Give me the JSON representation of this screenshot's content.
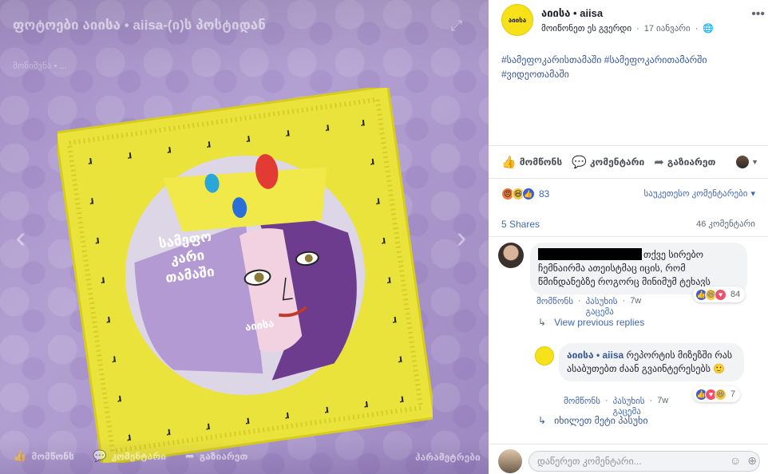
{
  "photo": {
    "title": "ფოტოები აიისა • aiisa-(ი)ს პოსტიდან",
    "subtitle": "მონიშვნა • ...",
    "expand_icon": "expand-icon",
    "package_label_lines": [
      "სამეფო",
      "კარი",
      "თამაში"
    ],
    "brand_mark": "აიისა",
    "bar": {
      "like": "მომწონს",
      "comment": "კომენტარი",
      "share": "გაზიარეთ",
      "options": "პარამეტრები"
    },
    "colors": {
      "background": "#a58fc6",
      "packet": "#e9e23a"
    }
  },
  "post": {
    "page_name": "აიისა • aiisa",
    "avatar_text": "აიისა",
    "like_page": "მოიწონეთ ეს გვერდი",
    "date": "17 იანვარი",
    "text_lines": [
      "#სამეფოკარისთამაში #სამეფოკარითამარში",
      "#ვიდეოთამაში"
    ]
  },
  "actions": {
    "like": "მომწონს",
    "comment": "კომენტარი",
    "share": "გაზიარეთ"
  },
  "stats": {
    "reaction_count": "83",
    "sort_label": "საუკეთესო კომენტარები",
    "shares": "5 Shares",
    "comments": "46 კომენტარი"
  },
  "comments": [
    {
      "text": "თქვე სირებო ჩემნაირმა ათეისტმაც იცის, რომ წმინდანებზე როგორც მინიმუმ ტეხავს",
      "like": "მომწონს",
      "reply": "პასუხის გაცემა",
      "time": "7w",
      "reaction_count": "84"
    }
  ],
  "view_previous": "View previous replies",
  "reply": {
    "author": "აიისა • aiisa",
    "text": "რეპორტის მიზეზში რას ასაბუთებთ ძაან გვაინტერესებს",
    "emoji": "🙂",
    "like": "მომწონს",
    "reply": "პასუხის გაცემა",
    "time": "7w",
    "reaction_count": "7"
  },
  "more_replies": "იხილეთ მეტი პასუხი",
  "composer": {
    "placeholder": "დაწერეთ კომენტარი..."
  }
}
